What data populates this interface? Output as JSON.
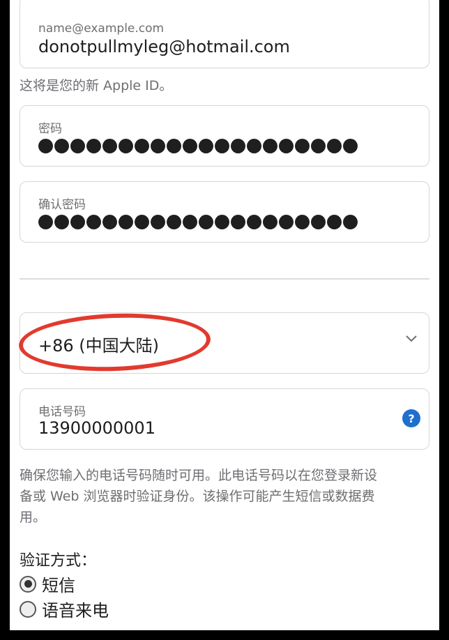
{
  "email": {
    "placeholder": "name@example.com",
    "value": "donotpullmyleg@hotmail.com",
    "hint": "这将是您的新 Apple ID。"
  },
  "password": {
    "label": "密码",
    "masked_length": 20
  },
  "confirm_password": {
    "label": "确认密码",
    "masked_length": 20
  },
  "country": {
    "selected": "+86 (中国大陆)",
    "icon": "chevron-down-icon"
  },
  "phone": {
    "label": "电话号码",
    "value": "13900000001",
    "help_glyph": "?"
  },
  "phone_note": "确保您输入的电话号码随时可用。此电话号码以在您登录新设备或 Web 浏览器时验证身份。该操作可能产生短信或数据费用。",
  "verification": {
    "label": "验证方式：",
    "options": [
      {
        "label": "短信",
        "selected": true
      },
      {
        "label": "语音来电",
        "selected": false
      }
    ]
  },
  "colors": {
    "accent": "#1f6fce",
    "annotation": "#e23a2e"
  }
}
